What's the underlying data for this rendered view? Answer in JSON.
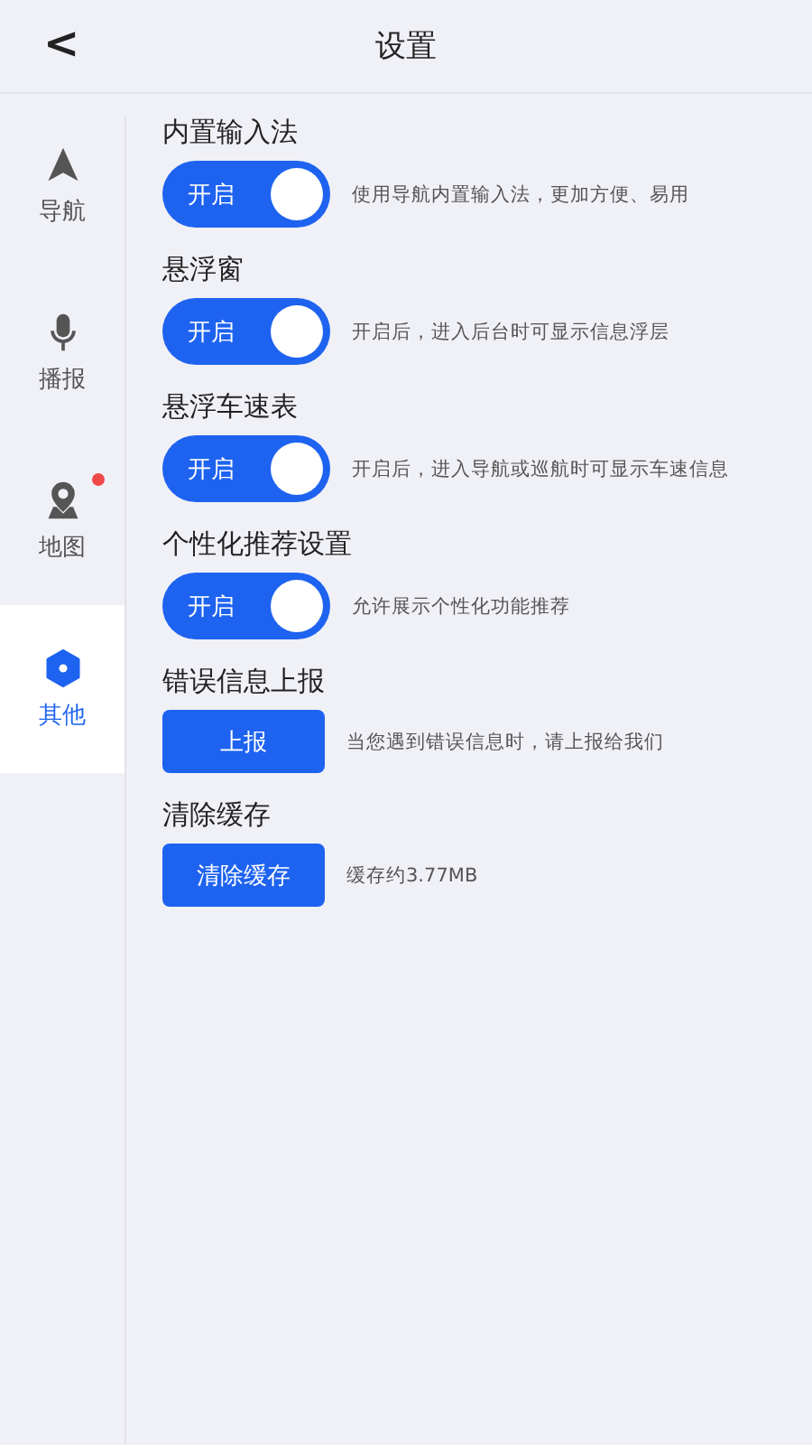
{
  "header": {
    "back": "<",
    "title": "设置"
  },
  "sidebar": {
    "items": [
      {
        "kind": "navigate",
        "label": "导航",
        "selected": false,
        "badge": false
      },
      {
        "kind": "mic",
        "label": "播报",
        "selected": false,
        "badge": false
      },
      {
        "kind": "map",
        "label": "地图",
        "selected": false,
        "badge": true
      },
      {
        "kind": "gear",
        "label": "其他",
        "selected": true,
        "badge": false
      }
    ]
  },
  "settings": [
    {
      "kind": "toggle",
      "title": "内置输入法",
      "control": "开启",
      "on": true,
      "description": "使用导航内置输入法，更加方便、易用"
    },
    {
      "kind": "toggle",
      "title": "悬浮窗",
      "control": "开启",
      "on": true,
      "description": "开启后，进入后台时可显示信息浮层"
    },
    {
      "kind": "toggle",
      "title": "悬浮车速表",
      "control": "开启",
      "on": true,
      "description": "开启后，进入导航或巡航时可显示车速信息"
    },
    {
      "kind": "toggle",
      "title": "个性化推荐设置",
      "control": "开启",
      "on": true,
      "description": "允许展示个性化功能推荐"
    },
    {
      "kind": "button",
      "title": "错误信息上报",
      "control": "上报",
      "description": "当您遇到错误信息时，请上报给我们"
    },
    {
      "kind": "button",
      "title": "清除缓存",
      "control": "清除缓存",
      "description": "缓存约3.77MB"
    }
  ]
}
